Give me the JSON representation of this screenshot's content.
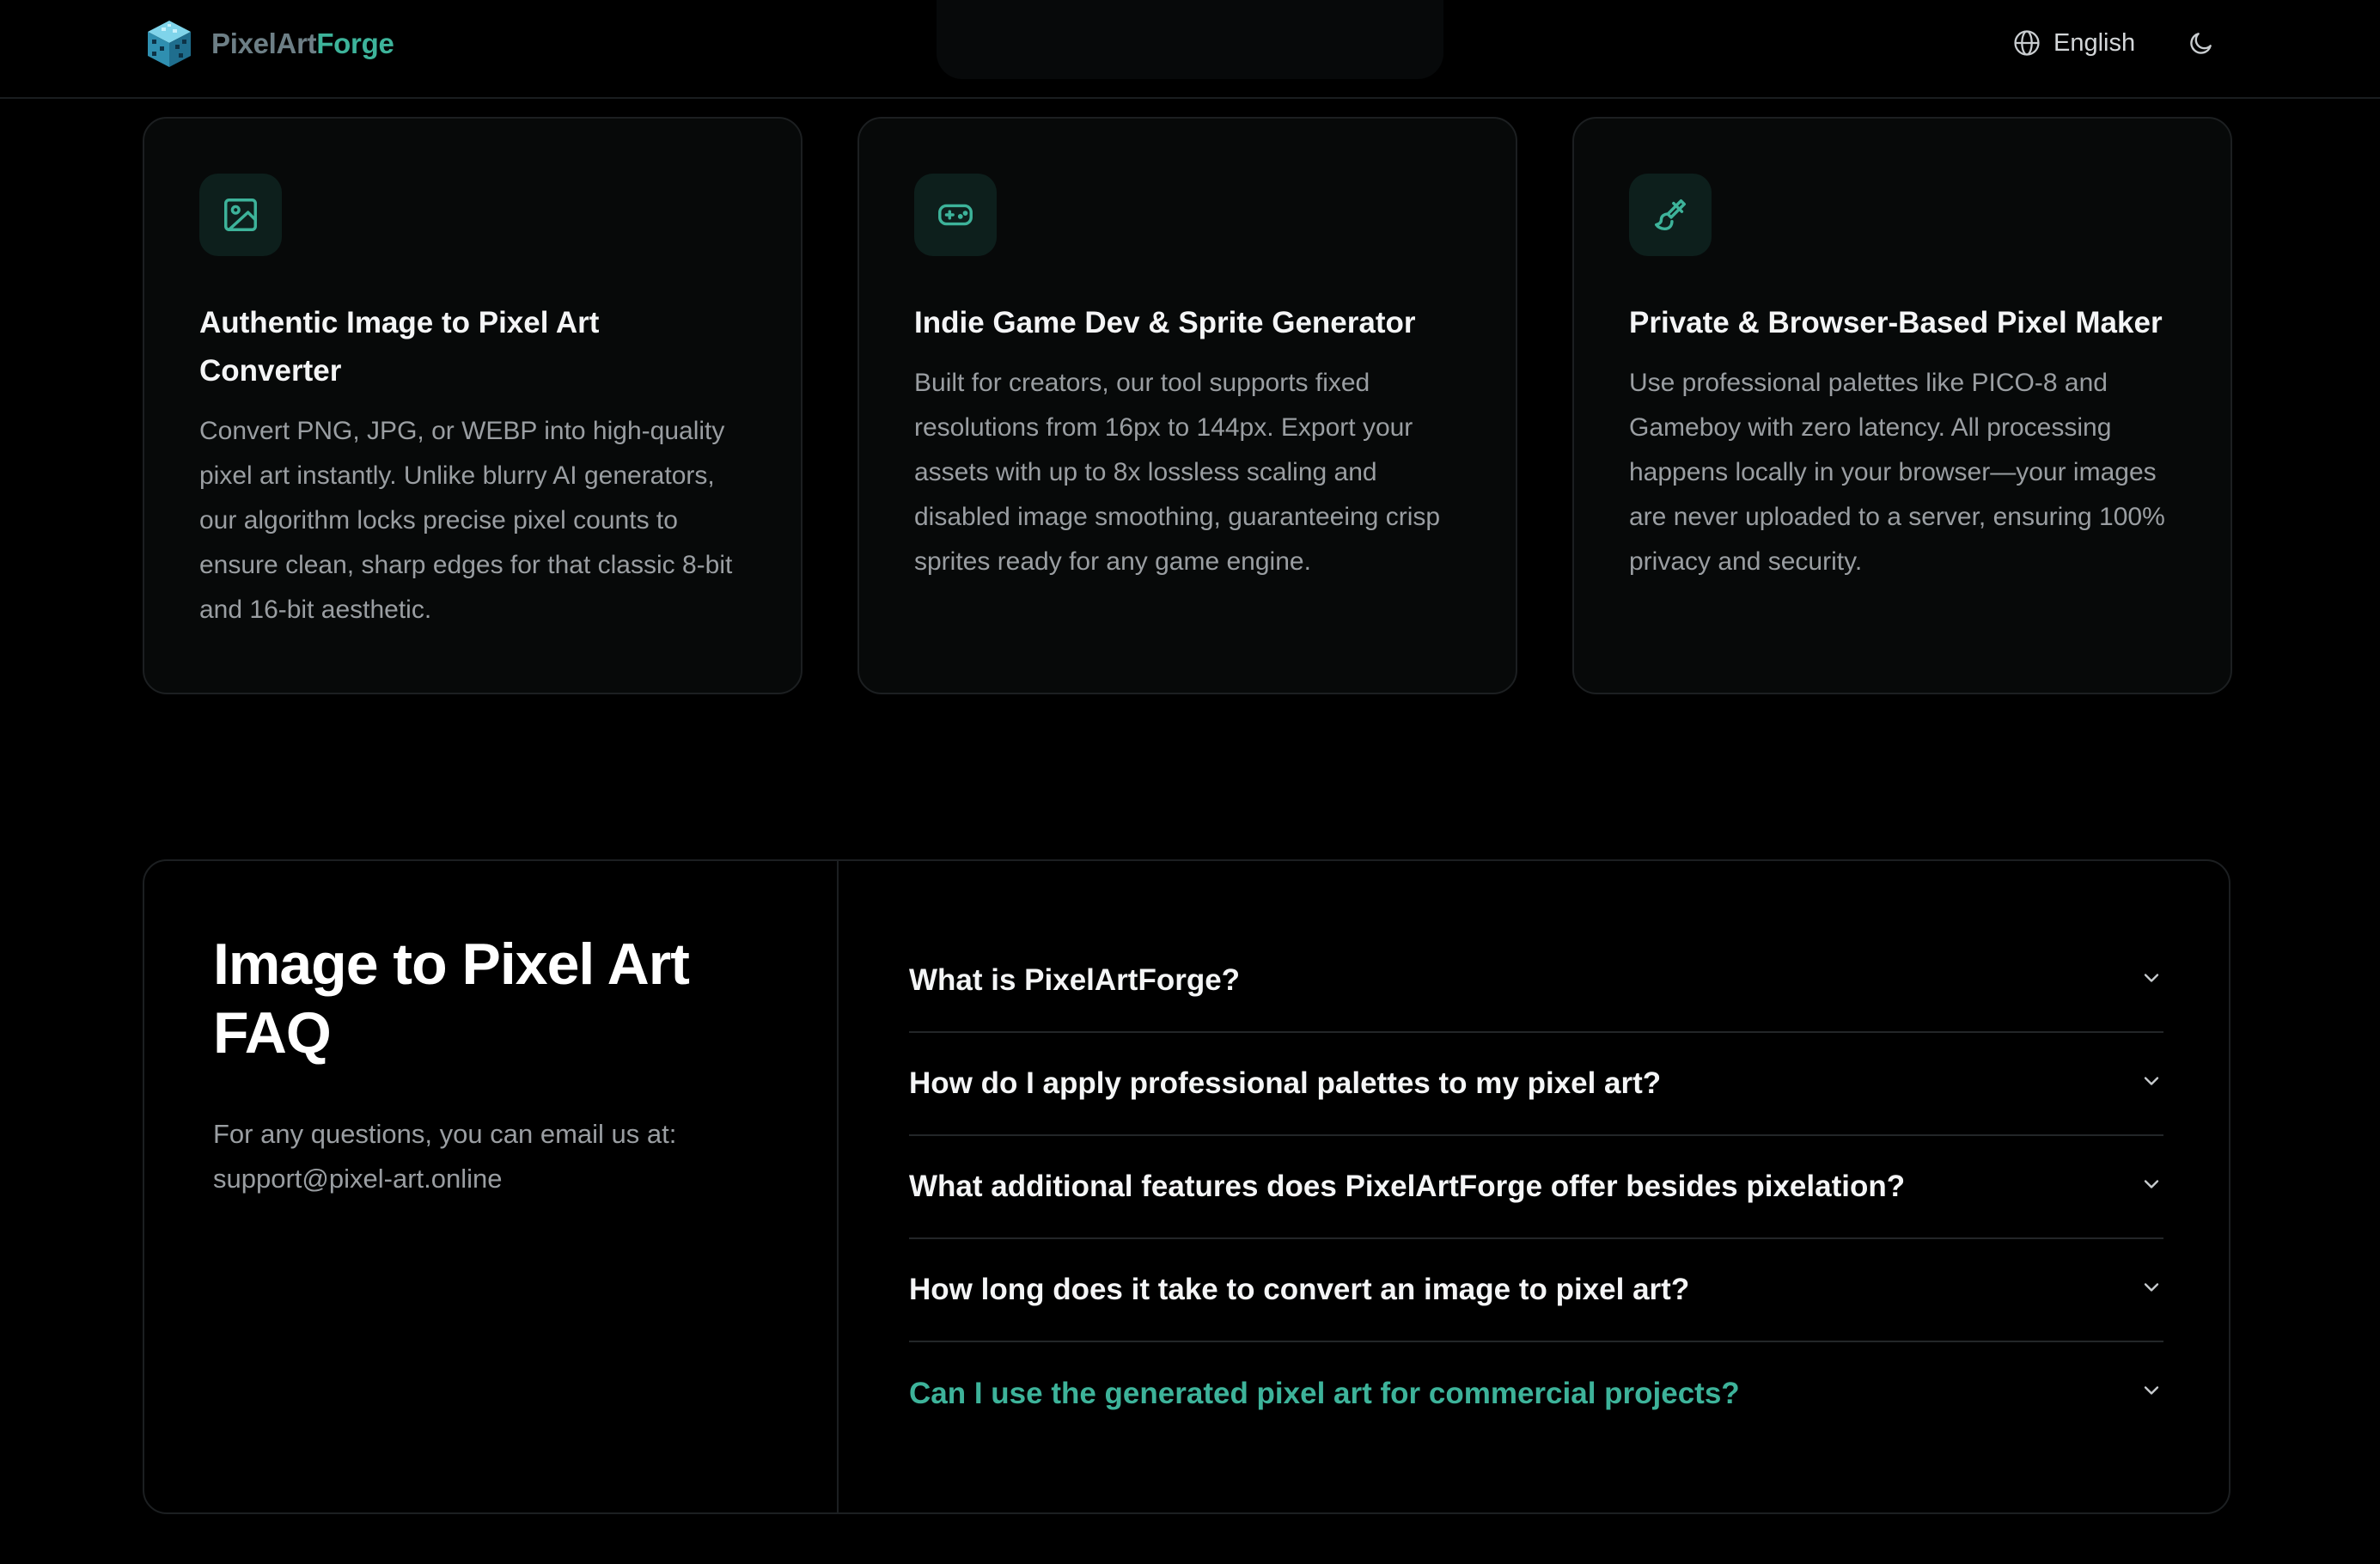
{
  "header": {
    "brand_part1": "PixelArt",
    "brand_part2": "Forge",
    "language": "English",
    "icons": {
      "logo": "cube-logo-icon",
      "language": "globe-icon",
      "theme": "moon-icon"
    }
  },
  "features": [
    {
      "icon": "image-icon",
      "title": "Authentic Image to Pixel Art Converter",
      "description": "Convert PNG, JPG, or WEBP into high-quality pixel art instantly. Unlike blurry AI generators, our algorithm locks precise pixel counts to ensure clean, sharp edges for that classic 8-bit and 16-bit aesthetic."
    },
    {
      "icon": "gamepad-icon",
      "title": "Indie Game Dev & Sprite Generator",
      "description": "Built for creators, our tool supports fixed resolutions from 16px to 144px. Export your assets with up to 8x lossless scaling and disabled image smoothing, guaranteeing crisp sprites ready for any game engine."
    },
    {
      "icon": "paintbrush-icon",
      "title": "Private & Browser-Based Pixel Maker",
      "description": "Use professional palettes like PICO-8 and Gameboy with zero latency. All processing happens locally in your browser—your images are never uploaded to a server, ensuring 100% privacy and security."
    }
  ],
  "faq": {
    "title": "Image to Pixel Art FAQ",
    "note": "For any questions, you can email us at:",
    "email": "support@pixel-art.online",
    "items": [
      {
        "question": "What is PixelArtForge?"
      },
      {
        "question": "How do I apply professional palettes to my pixel art?"
      },
      {
        "question": "What additional features does PixelArtForge offer besides pixelation?"
      },
      {
        "question": "How long does it take to convert an image to pixel art?"
      },
      {
        "question": "Can I use the generated pixel art for commercial projects?"
      }
    ],
    "highlighted_index": 4
  },
  "colors": {
    "background": "#000000",
    "accent": "#3db39a",
    "card_background": "#070909",
    "border": "#1c1f21",
    "muted_text": "#9a9ea2"
  }
}
